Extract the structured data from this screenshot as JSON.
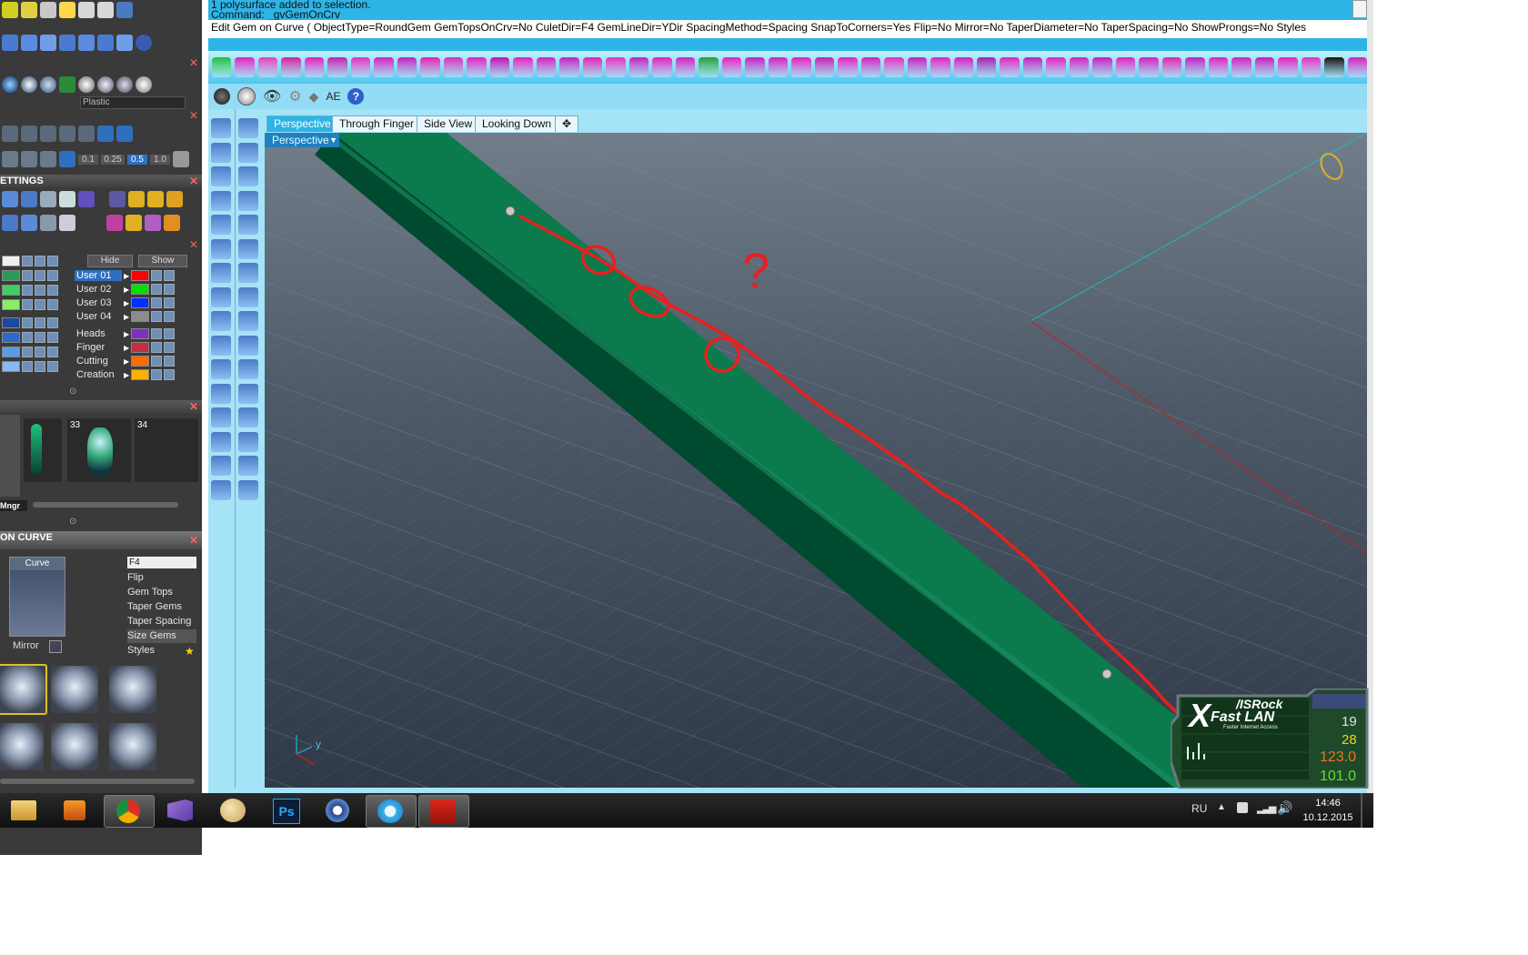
{
  "command": {
    "line1": "1 polysurface added to selection.",
    "line2": "Command: _gvGemOnCrv",
    "prompt": "Edit Gem on Curve ( ObjectType=RoundGem  GemTopsOnCrv=No  CuletDir=F4  GemLineDir=YDir  SpacingMethod=Spacing  SnapToCorners=Yes  Flip=No  Mirror=No  TaperDiameter=No  TaperSpacing=No  ShowProngs=No  Styles"
  },
  "left_panel": {
    "material_label": "Plastic",
    "snap_values": [
      "0.1",
      "0.25",
      "0.5",
      "1.0"
    ],
    "settings_title": "ETTINGS",
    "layers": {
      "hide_label": "Hide",
      "show_label": "Show",
      "user_layers": [
        {
          "name": "User 01",
          "color": "#ff0000"
        },
        {
          "name": "User 02",
          "color": "#00e000"
        },
        {
          "name": "User 03",
          "color": "#0030ff"
        },
        {
          "name": "User 04",
          "color": "#8c8c8c"
        }
      ],
      "group_layers": [
        {
          "name": "Heads",
          "color": "#8030c0"
        },
        {
          "name": "Finger",
          "color": "#c03040"
        },
        {
          "name": "Cutting",
          "color": "#ff6a00"
        },
        {
          "name": "Creation",
          "color": "#ffb000"
        }
      ]
    },
    "library": {
      "items": [
        "33",
        "34"
      ],
      "mgr_label": "Mngr"
    },
    "gem_on_curve": {
      "title": "ON CURVE",
      "curve_label": "Curve",
      "mirror_label": "Mirror",
      "culet_value": "F4",
      "props": [
        "Flip",
        "Gem Tops",
        "Taper Gems",
        "Taper Spacing",
        "Size Gems",
        "Styles"
      ]
    }
  },
  "display_bar": {
    "ae_label": "AE"
  },
  "viewport": {
    "tabs": [
      "Perspective",
      "Through Finger",
      "Side View",
      "Looking Down"
    ],
    "active_tab": "Perspective",
    "label": "Perspective",
    "annotation": "?",
    "axis_y": "y"
  },
  "asrock": {
    "brand": "/ISRock",
    "product": "Fast LAN",
    "tagline": "Faster Internet Access",
    "stats": [
      "19",
      "28",
      "123.0",
      "101.0"
    ]
  },
  "taskbar": {
    "ps_label": "Ps",
    "lang": "RU",
    "time": "14:46",
    "date": "10.12.2015"
  }
}
